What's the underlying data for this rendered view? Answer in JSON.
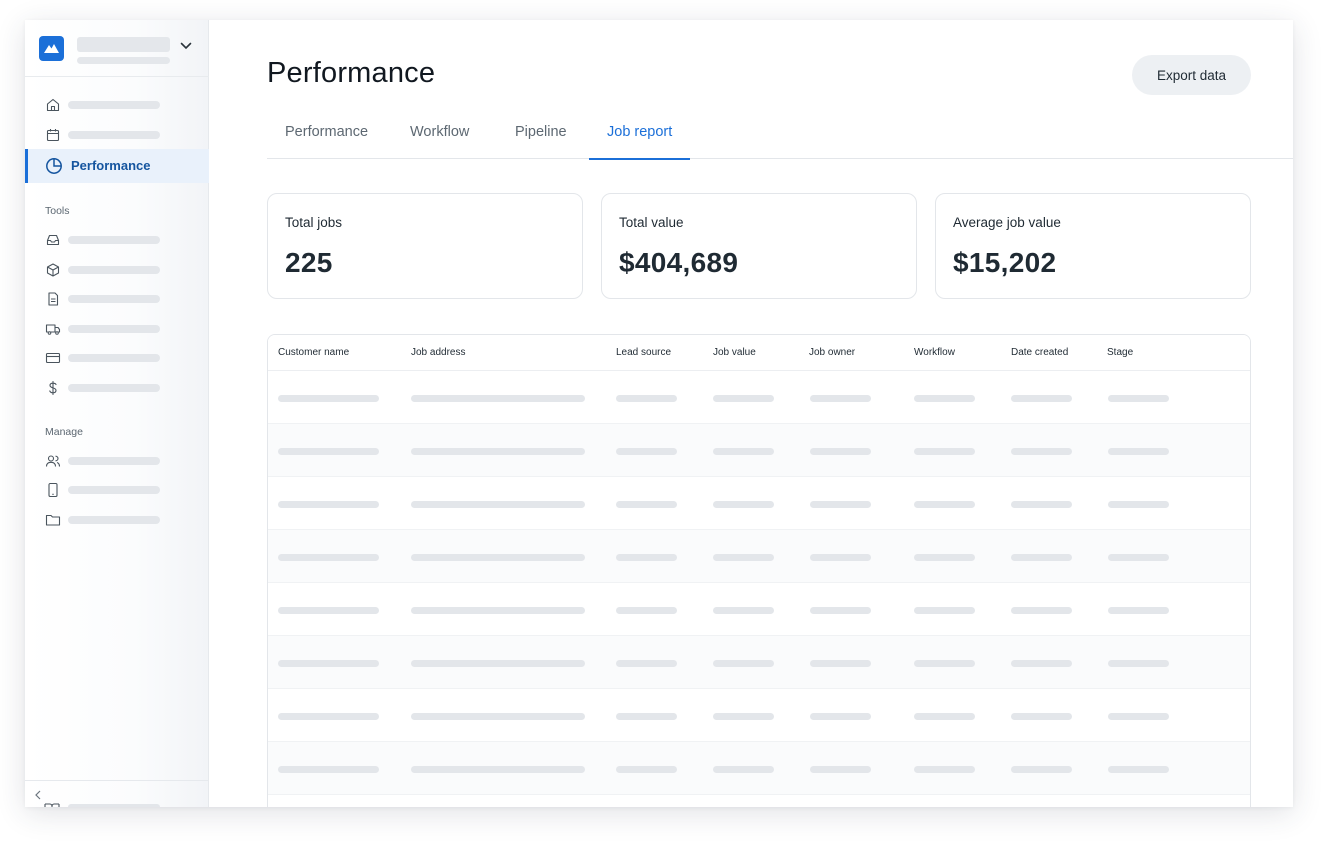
{
  "page": {
    "title": "Performance",
    "export_label": "Export data"
  },
  "sidebar": {
    "active_item": "Performance",
    "sections": {
      "tools": "Tools",
      "manage": "Manage"
    },
    "icons": {
      "top": [
        "home-icon",
        "calendar-icon",
        "pie-chart-icon"
      ],
      "tools": [
        "inbox-icon",
        "box-icon",
        "document-icon",
        "truck-icon",
        "credit-card-icon",
        "dollar-icon"
      ],
      "manage": [
        "users-icon",
        "mobile-icon",
        "folder-icon"
      ]
    }
  },
  "tabs": [
    {
      "label": "Performance",
      "active": false
    },
    {
      "label": "Workflow",
      "active": false
    },
    {
      "label": "Pipeline",
      "active": false
    },
    {
      "label": "Job report",
      "active": true
    }
  ],
  "stats": [
    {
      "label": "Total jobs",
      "value": "225"
    },
    {
      "label": "Total value",
      "value": "$404,689"
    },
    {
      "label": "Average job value",
      "value": "$15,202"
    }
  ],
  "table": {
    "columns": [
      "Customer name",
      "Job address",
      "Lead source",
      "Job value",
      "Job owner",
      "Workflow",
      "Date created",
      "Stage"
    ]
  },
  "colors": {
    "accent": "#1b6fd8",
    "active_bg": "#e9f1fb",
    "placeholder": "#e3e6ea"
  }
}
